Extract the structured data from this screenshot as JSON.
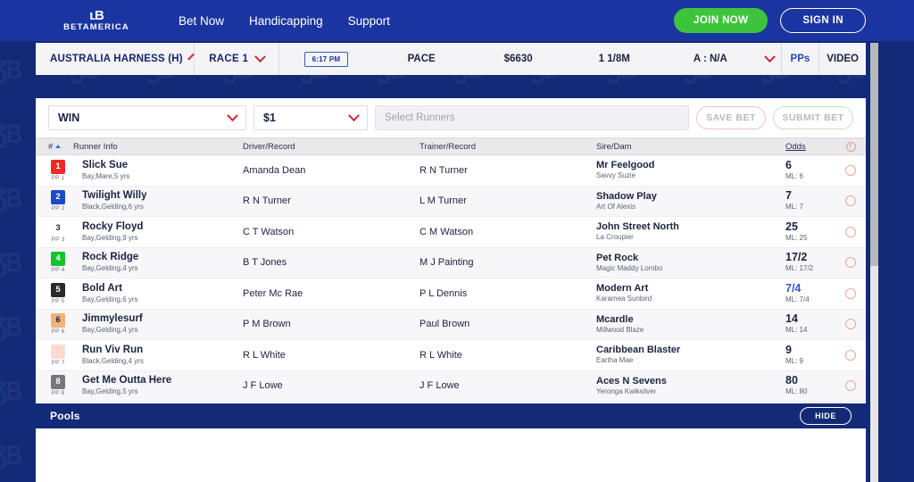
{
  "brand": {
    "logo_mark": "ᴮ",
    "logo_text": "BETAMERICA",
    "accent_navy": "#132a76",
    "accent_blue": "#1b35a0",
    "accent_green": "#3cc53c",
    "accent_red": "#d4233c",
    "favorite_odds_color": "#3358c9"
  },
  "topnav": {
    "links": [
      {
        "label": "Bet Now",
        "name": "nav-bet-now"
      },
      {
        "label": "Handicapping",
        "name": "nav-handicapping"
      },
      {
        "label": "Support",
        "name": "nav-support"
      }
    ],
    "join_now_label": "JOIN NOW",
    "sign_in_label": "SIGN IN"
  },
  "race_info": {
    "track": "AUSTRALIA HARNESS (H)",
    "race": "RACE 1",
    "post_time": "6:17 PM",
    "race_type": "PACE",
    "purse": "$6630",
    "distance": "1 1/8M",
    "age_restriction": "A : N/A",
    "pps_label": "PPs",
    "video_label": "VIDEO"
  },
  "bet_controls": {
    "bet_type": "WIN",
    "bet_amount": "$1",
    "runners_placeholder": "Select Runners",
    "runners_value": "",
    "save_bet_label": "SAVE BET",
    "submit_bet_label": "SUBMIT BET"
  },
  "table": {
    "headers": {
      "number": "#",
      "runner_info": "Runner Info",
      "driver_record": "Driver/Record",
      "trainer_record": "Trainer/Record",
      "sire_dam": "Sire/Dam",
      "odds": "Odds"
    },
    "rows": [
      {
        "number": "1",
        "pp": "PP 1",
        "saddle_bg": "#ee2a24",
        "saddle_fg": "#ffffff",
        "runner_name": "Slick Sue",
        "runner_desc": "Bay,Mare,5 yrs",
        "driver": "Amanda Dean",
        "trainer": "R N Turner",
        "sire": "Mr Feelgood",
        "dam": "Savvy Suzie",
        "odds": "6",
        "morning_line": "ML: 6",
        "is_favorite": false
      },
      {
        "number": "2",
        "pp": "PP 2",
        "saddle_bg": "#1c49c4",
        "saddle_fg": "#ffffff",
        "runner_name": "Twilight Willy",
        "runner_desc": "Black,Gelding,6 yrs",
        "driver": "R N Turner",
        "trainer": "L M Turner",
        "sire": "Shadow Play",
        "dam": "Art Of Alexis",
        "odds": "7",
        "morning_line": "ML: 7",
        "is_favorite": false
      },
      {
        "number": "3",
        "pp": "PP 3",
        "saddle_bg": "#ffffff",
        "saddle_fg": "#1b2340",
        "runner_name": "Rocky Floyd",
        "runner_desc": "Bay,Gelding,9 yrs",
        "driver": "C T Watson",
        "trainer": "C M Watson",
        "sire": "John Street North",
        "dam": "La Croupier",
        "odds": "25",
        "morning_line": "ML: 25",
        "is_favorite": false
      },
      {
        "number": "4",
        "pp": "PP 4",
        "saddle_bg": "#13c52a",
        "saddle_fg": "#ffffff",
        "runner_name": "Rock Ridge",
        "runner_desc": "Bay,Gelding,4 yrs",
        "driver": "B T Jones",
        "trainer": "M J Painting",
        "sire": "Pet Rock",
        "dam": "Magic Maddy Lombo",
        "odds": "17/2",
        "morning_line": "ML: 17/2",
        "is_favorite": false
      },
      {
        "number": "5",
        "pp": "PP 5",
        "saddle_bg": "#2a2a2e",
        "saddle_fg": "#ffffff",
        "runner_name": "Bold Art",
        "runner_desc": "Bay,Gelding,6 yrs",
        "driver": "Peter Mc Rae",
        "trainer": "P L Dennis",
        "sire": "Modern Art",
        "dam": "Karamea Sunbird",
        "odds": "7/4",
        "morning_line": "ML: 7/4",
        "is_favorite": true
      },
      {
        "number": "6",
        "pp": "PP 6",
        "saddle_bg": "#f0b27a",
        "saddle_fg": "#1b2340",
        "runner_name": "Jimmylesurf",
        "runner_desc": "Bay,Gelding,4 yrs",
        "driver": "P M Brown",
        "trainer": "Paul Brown",
        "sire": "Mcardle",
        "dam": "Millwood Blaze",
        "odds": "14",
        "morning_line": "ML: 14",
        "is_favorite": false
      },
      {
        "number": "7",
        "pp": "PP 7",
        "saddle_bg": "#fadcd4",
        "saddle_fg": "#f5cdc3",
        "runner_name": "Run Viv Run",
        "runner_desc": "Black,Gelding,4 yrs",
        "driver": "R L White",
        "trainer": "R L White",
        "sire": "Caribbean Blaster",
        "dam": "Eartha Mae",
        "odds": "9",
        "morning_line": "ML: 9",
        "is_favorite": false
      },
      {
        "number": "8",
        "pp": "PP 8",
        "saddle_bg": "#76767c",
        "saddle_fg": "#ffffff",
        "runner_name": "Get Me Outta Here",
        "runner_desc": "Bay,Gelding,5 yrs",
        "driver": "J F Lowe",
        "trainer": "J F Lowe",
        "sire": "Aces N Sevens",
        "dam": "Yeronga Kwiksilver",
        "odds": "80",
        "morning_line": "ML: 80",
        "is_favorite": false
      }
    ]
  },
  "pools": {
    "title": "Pools",
    "hide_label": "HIDE"
  }
}
